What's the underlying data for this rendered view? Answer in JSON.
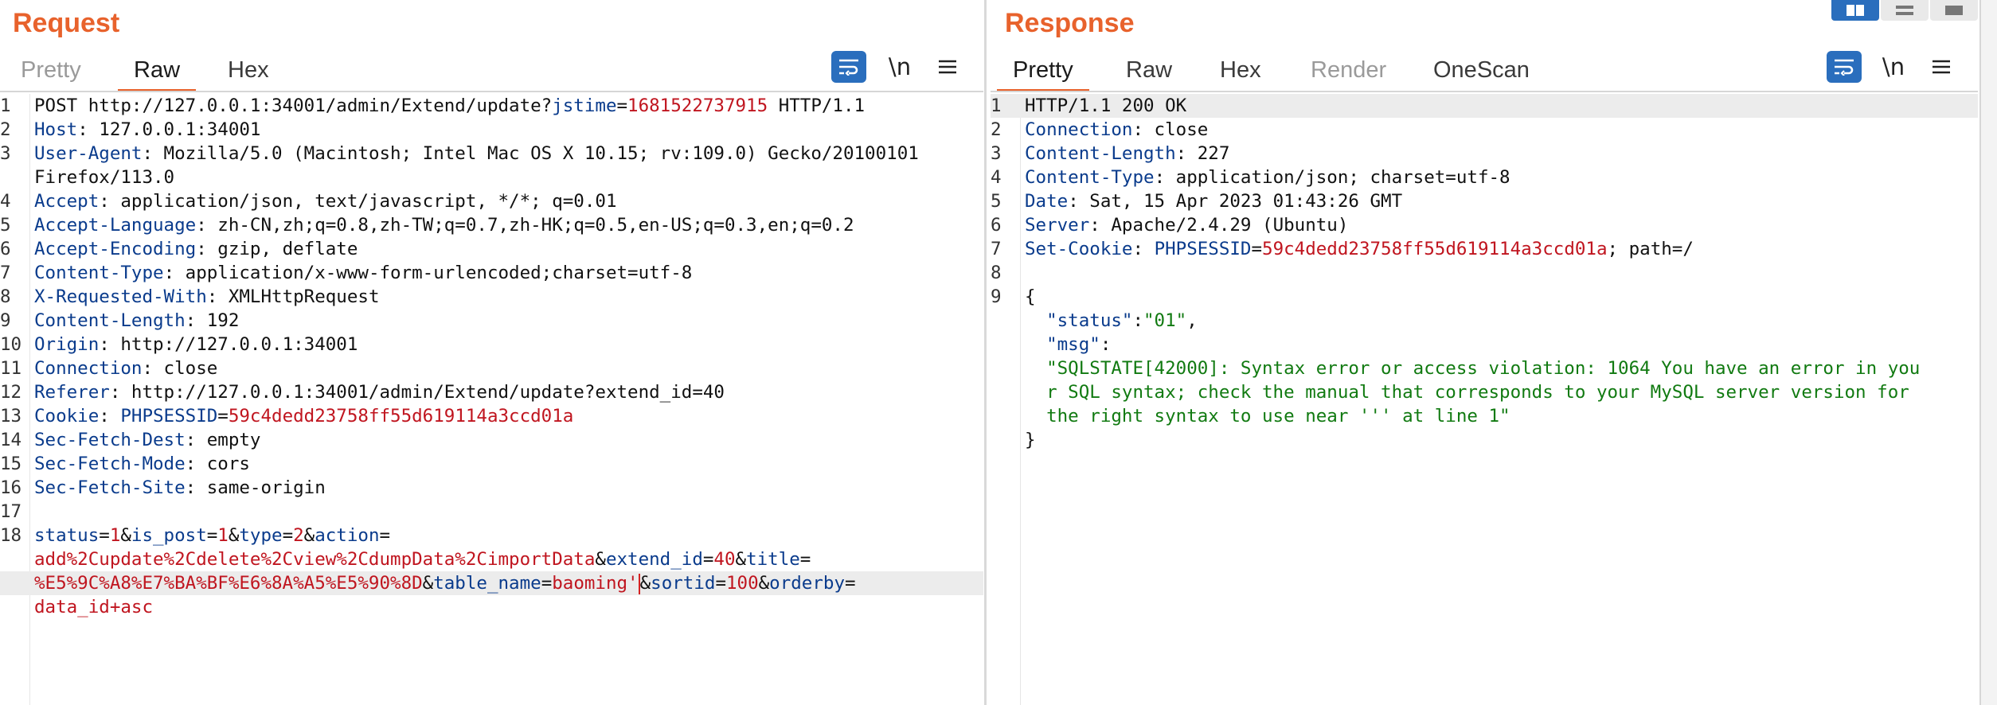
{
  "request": {
    "title": "Request",
    "tabs": [
      "Pretty",
      "Raw",
      "Hex"
    ],
    "active_tab": "Raw",
    "newline_label": "\\n",
    "lines": [
      {
        "num": "1",
        "segments": [
          {
            "t": "POST http://127.0.0.1:34001/admin/Extend/update?",
            "c": "hv"
          },
          {
            "t": "jstime",
            "c": "hn"
          },
          {
            "t": "=",
            "c": "hv"
          },
          {
            "t": "1681522737915",
            "c": "cv"
          },
          {
            "t": " HTTP/1.1",
            "c": "hv"
          }
        ]
      },
      {
        "num": "2",
        "segments": [
          {
            "t": "Host",
            "c": "hn"
          },
          {
            "t": ": 127.0.0.1:34001",
            "c": "hv"
          }
        ]
      },
      {
        "num": "3",
        "segments": [
          {
            "t": "User-Agent",
            "c": "hn"
          },
          {
            "t": ": Mozilla/5.0 (Macintosh; Intel Mac OS X 10.15; rv:109.0) Gecko/20100101",
            "c": "hv"
          }
        ]
      },
      {
        "num": "",
        "segments": [
          {
            "t": "Firefox/113.0",
            "c": "hv"
          }
        ]
      },
      {
        "num": "4",
        "segments": [
          {
            "t": "Accept",
            "c": "hn"
          },
          {
            "t": ": application/json, text/javascript, */*; q=0.01",
            "c": "hv"
          }
        ]
      },
      {
        "num": "5",
        "segments": [
          {
            "t": "Accept-Language",
            "c": "hn"
          },
          {
            "t": ": zh-CN,zh;q=0.8,zh-TW;q=0.7,zh-HK;q=0.5,en-US;q=0.3,en;q=0.2",
            "c": "hv"
          }
        ]
      },
      {
        "num": "6",
        "segments": [
          {
            "t": "Accept-Encoding",
            "c": "hn"
          },
          {
            "t": ": gzip, deflate",
            "c": "hv"
          }
        ]
      },
      {
        "num": "7",
        "segments": [
          {
            "t": "Content-Type",
            "c": "hn"
          },
          {
            "t": ": application/x-www-form-urlencoded;charset=utf-8",
            "c": "hv"
          }
        ]
      },
      {
        "num": "8",
        "segments": [
          {
            "t": "X-Requested-With",
            "c": "hn"
          },
          {
            "t": ": XMLHttpRequest",
            "c": "hv"
          }
        ]
      },
      {
        "num": "9",
        "segments": [
          {
            "t": "Content-Length",
            "c": "hn"
          },
          {
            "t": ": 192",
            "c": "hv"
          }
        ]
      },
      {
        "num": "10",
        "segments": [
          {
            "t": "Origin",
            "c": "hn"
          },
          {
            "t": ": http://127.0.0.1:34001",
            "c": "hv"
          }
        ]
      },
      {
        "num": "11",
        "segments": [
          {
            "t": "Connection",
            "c": "hn"
          },
          {
            "t": ": close",
            "c": "hv"
          }
        ]
      },
      {
        "num": "12",
        "segments": [
          {
            "t": "Referer",
            "c": "hn"
          },
          {
            "t": ": http://127.0.0.1:34001/admin/Extend/update?extend_id=40",
            "c": "hv"
          }
        ]
      },
      {
        "num": "13",
        "segments": [
          {
            "t": "Cookie",
            "c": "hn"
          },
          {
            "t": ": ",
            "c": "hv"
          },
          {
            "t": "PHPSESSID",
            "c": "hn"
          },
          {
            "t": "=",
            "c": "hv"
          },
          {
            "t": "59c4dedd23758ff55d619114a3ccd01a",
            "c": "cv"
          }
        ]
      },
      {
        "num": "14",
        "segments": [
          {
            "t": "Sec-Fetch-Dest",
            "c": "hn"
          },
          {
            "t": ": empty",
            "c": "hv"
          }
        ]
      },
      {
        "num": "15",
        "segments": [
          {
            "t": "Sec-Fetch-Mode",
            "c": "hn"
          },
          {
            "t": ": cors",
            "c": "hv"
          }
        ]
      },
      {
        "num": "16",
        "segments": [
          {
            "t": "Sec-Fetch-Site",
            "c": "hn"
          },
          {
            "t": ": same-origin",
            "c": "hv"
          }
        ]
      },
      {
        "num": "17",
        "segments": []
      },
      {
        "num": "18",
        "segments": [
          {
            "t": "status",
            "c": "hn"
          },
          {
            "t": "=",
            "c": "hv"
          },
          {
            "t": "1",
            "c": "cv"
          },
          {
            "t": "&",
            "c": "hv"
          },
          {
            "t": "is_post",
            "c": "hn"
          },
          {
            "t": "=",
            "c": "hv"
          },
          {
            "t": "1",
            "c": "cv"
          },
          {
            "t": "&",
            "c": "hv"
          },
          {
            "t": "type",
            "c": "hn"
          },
          {
            "t": "=",
            "c": "hv"
          },
          {
            "t": "2",
            "c": "cv"
          },
          {
            "t": "&",
            "c": "hv"
          },
          {
            "t": "action",
            "c": "hn"
          },
          {
            "t": "=",
            "c": "hv"
          }
        ]
      },
      {
        "num": "",
        "segments": [
          {
            "t": "add%2Cupdate%2Cdelete%2Cview%2CdumpData%2CimportData",
            "c": "cv"
          },
          {
            "t": "&",
            "c": "hv"
          },
          {
            "t": "extend_id",
            "c": "hn"
          },
          {
            "t": "=",
            "c": "hv"
          },
          {
            "t": "40",
            "c": "cv"
          },
          {
            "t": "&",
            "c": "hv"
          },
          {
            "t": "title",
            "c": "hn"
          },
          {
            "t": "=",
            "c": "hv"
          }
        ]
      },
      {
        "num": "",
        "highlight": true,
        "segments": [
          {
            "t": "%E5%9C%A8%E7%BA%BF%E6%8A%A5%E5%90%8D",
            "c": "cv"
          },
          {
            "t": "&",
            "c": "hv"
          },
          {
            "t": "table_name",
            "c": "hn"
          },
          {
            "t": "=",
            "c": "hv"
          },
          {
            "t": "baoming'",
            "c": "cv"
          },
          {
            "t": "|",
            "c": "cursor"
          },
          {
            "t": "&",
            "c": "hv"
          },
          {
            "t": "sortid",
            "c": "hn"
          },
          {
            "t": "=",
            "c": "hv"
          },
          {
            "t": "100",
            "c": "cv"
          },
          {
            "t": "&",
            "c": "hv"
          },
          {
            "t": "orderby",
            "c": "hn"
          },
          {
            "t": "=",
            "c": "hv"
          }
        ]
      },
      {
        "num": "",
        "segments": [
          {
            "t": "data_id+asc",
            "c": "cv"
          }
        ]
      }
    ]
  },
  "response": {
    "title": "Response",
    "tabs": [
      "Pretty",
      "Raw",
      "Hex",
      "Render",
      "OneScan"
    ],
    "active_tab": "Pretty",
    "muted_tab": "Render",
    "newline_label": "\\n",
    "lines": [
      {
        "num": "1",
        "highlight": true,
        "segments": [
          {
            "t": "HTTP/1.1 200 OK",
            "c": "hv"
          }
        ]
      },
      {
        "num": "2",
        "segments": [
          {
            "t": "Connection",
            "c": "hn"
          },
          {
            "t": ": close",
            "c": "hv"
          }
        ]
      },
      {
        "num": "3",
        "segments": [
          {
            "t": "Content-Length",
            "c": "hn"
          },
          {
            "t": ": 227",
            "c": "hv"
          }
        ]
      },
      {
        "num": "4",
        "segments": [
          {
            "t": "Content-Type",
            "c": "hn"
          },
          {
            "t": ": application/json; charset=utf-8",
            "c": "hv"
          }
        ]
      },
      {
        "num": "5",
        "segments": [
          {
            "t": "Date",
            "c": "hn"
          },
          {
            "t": ": Sat, 15 Apr 2023 01:43:26 GMT",
            "c": "hv"
          }
        ]
      },
      {
        "num": "6",
        "segments": [
          {
            "t": "Server",
            "c": "hn"
          },
          {
            "t": ": Apache/2.4.29 (Ubuntu)",
            "c": "hv"
          }
        ]
      },
      {
        "num": "7",
        "segments": [
          {
            "t": "Set-Cookie",
            "c": "hn"
          },
          {
            "t": ": ",
            "c": "hv"
          },
          {
            "t": "PHPSESSID",
            "c": "hn"
          },
          {
            "t": "=",
            "c": "hv"
          },
          {
            "t": "59c4dedd23758ff55d619114a3ccd01a",
            "c": "cv"
          },
          {
            "t": "; path=/",
            "c": "hv"
          }
        ]
      },
      {
        "num": "8",
        "segments": []
      },
      {
        "num": "9",
        "segments": [
          {
            "t": "{",
            "c": "hv"
          }
        ]
      },
      {
        "num": "",
        "segments": [
          {
            "t": "  ",
            "c": "hv"
          },
          {
            "t": "\"status\"",
            "c": "jk"
          },
          {
            "t": ":",
            "c": "hv"
          },
          {
            "t": "\"01\"",
            "c": "jv"
          },
          {
            "t": ",",
            "c": "hv"
          }
        ]
      },
      {
        "num": "",
        "segments": [
          {
            "t": "  ",
            "c": "hv"
          },
          {
            "t": "\"msg\"",
            "c": "jk"
          },
          {
            "t": ":",
            "c": "hv"
          }
        ]
      },
      {
        "num": "",
        "segments": [
          {
            "t": "  \"SQLSTATE[42000]: Syntax error or access violation: 1064 You have an error in you",
            "c": "jv"
          }
        ]
      },
      {
        "num": "",
        "segments": [
          {
            "t": "  r SQL syntax; check the manual that corresponds to your MySQL server version for",
            "c": "jv"
          }
        ]
      },
      {
        "num": "",
        "segments": [
          {
            "t": "  the right syntax to use near ''' at line 1\"",
            "c": "jv"
          }
        ]
      },
      {
        "num": "",
        "segments": [
          {
            "t": "}",
            "c": "hv"
          }
        ]
      }
    ]
  },
  "icons": {
    "wrap": "wrap-lines-icon",
    "menu": "hamburger-menu-icon"
  },
  "colors": {
    "accent": "#e8622c",
    "header_name": "#0a3b8c",
    "value_red": "#c0151f",
    "json_green": "#117a11",
    "active_blue": "#2a6ebd"
  }
}
